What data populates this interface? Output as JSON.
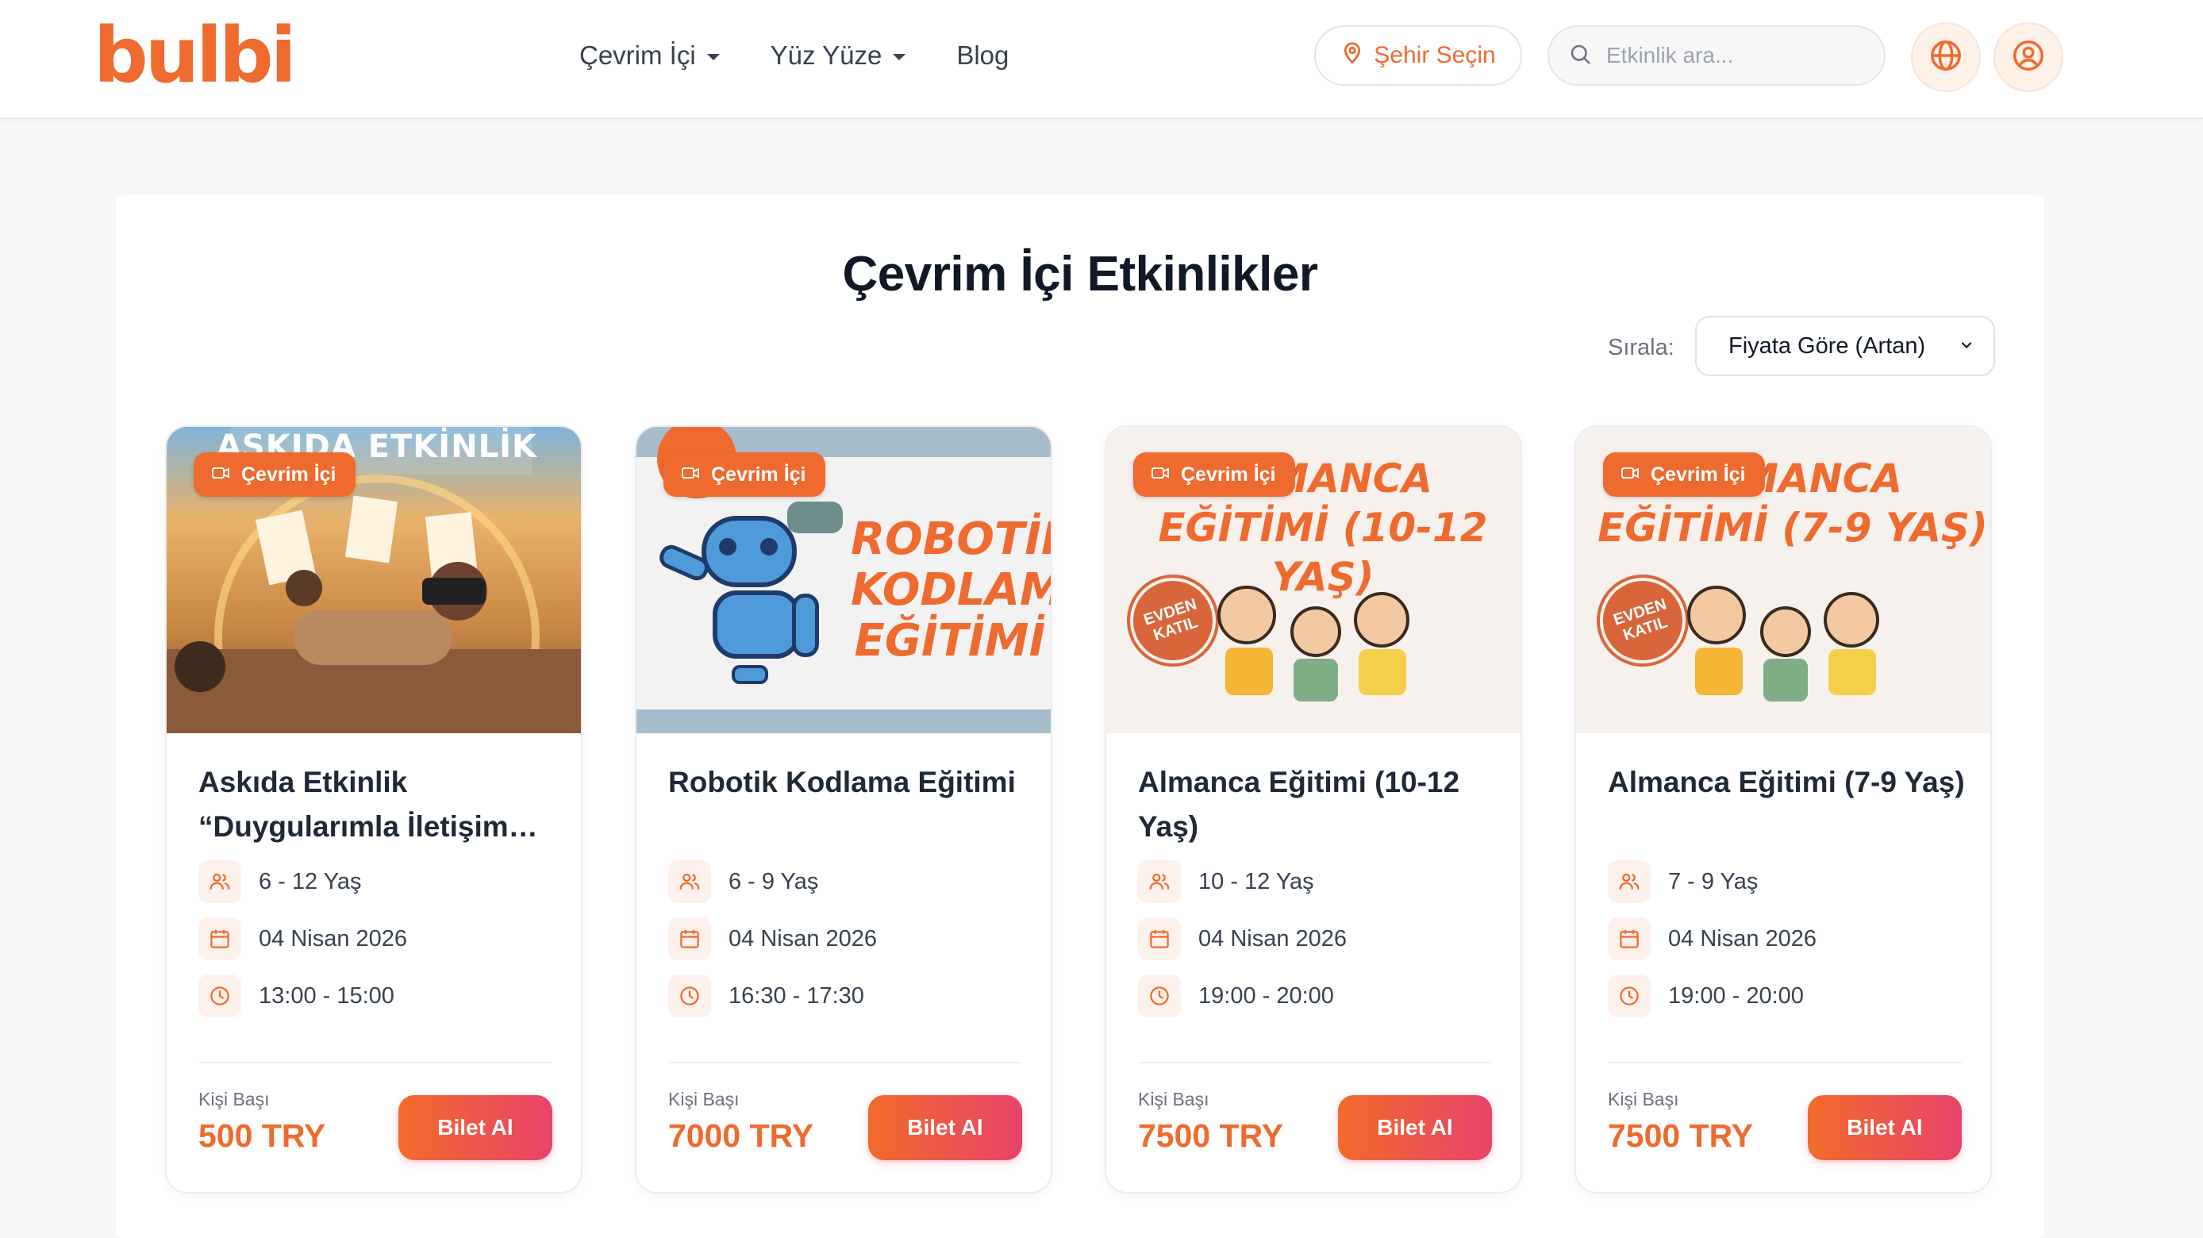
{
  "brand": {
    "logo_text": "bulbi",
    "accent": "#ef6a2e"
  },
  "nav": {
    "items": [
      {
        "label": "Çevrim İçi",
        "has_dropdown": true
      },
      {
        "label": "Yüz Yüze",
        "has_dropdown": true
      },
      {
        "label": "Blog",
        "has_dropdown": false
      }
    ]
  },
  "header": {
    "city_button": "Şehir Seçin",
    "search_placeholder": "Etkinlik ara...",
    "language_icon": "globe-icon",
    "account_icon": "user-icon"
  },
  "main": {
    "title": "Çevrim İçi Etkinlikler",
    "sort_label": "Sırala:",
    "sort_value": "Fiyata Göre (Artan)"
  },
  "cards": [
    {
      "badge": "Çevrim İçi",
      "image_text": "ASKIDA ETKİNLİK",
      "title": "Askıda Etkinlik “Duygularımla İletişim…",
      "age": "6 - 12 Yaş",
      "date": "04 Nisan 2026",
      "time": "13:00 - 15:00",
      "price_label": "Kişi Başı",
      "price": "500 TRY",
      "button": "Bilet Al"
    },
    {
      "badge": "Çevrim İçi",
      "image_text_lines": [
        "ROBOTİK",
        "KODLAMA",
        "EĞİTİMİ"
      ],
      "title": "Robotik Kodlama Eğitimi",
      "age": "6 - 9 Yaş",
      "date": "04 Nisan 2026",
      "time": "16:30 - 17:30",
      "price_label": "Kişi Başı",
      "price": "7000 TRY",
      "button": "Bilet Al"
    },
    {
      "badge": "Çevrim İçi",
      "image_text_lines": [
        "ALMANCA",
        "EĞİTİMİ (10-12 YAŞ)"
      ],
      "stamp_text": "EVDEN KATIL",
      "title": "Almanca Eğitimi (10-12 Yaş)",
      "age": "10 - 12 Yaş",
      "date": "04 Nisan 2026",
      "time": "19:00 - 20:00",
      "price_label": "Kişi Başı",
      "price": "7500 TRY",
      "button": "Bilet Al"
    },
    {
      "badge": "Çevrim İçi",
      "image_text_lines": [
        "ALMANCA",
        "EĞİTİMİ (7-9 YAŞ)"
      ],
      "stamp_text": "EVDEN KATIL",
      "title": "Almanca Eğitimi (7-9 Yaş)",
      "age": "7 - 9 Yaş",
      "date": "04 Nisan 2026",
      "time": "19:00 - 20:00",
      "price_label": "Kişi Başı",
      "price": "7500 TRY",
      "button": "Bilet Al"
    }
  ]
}
